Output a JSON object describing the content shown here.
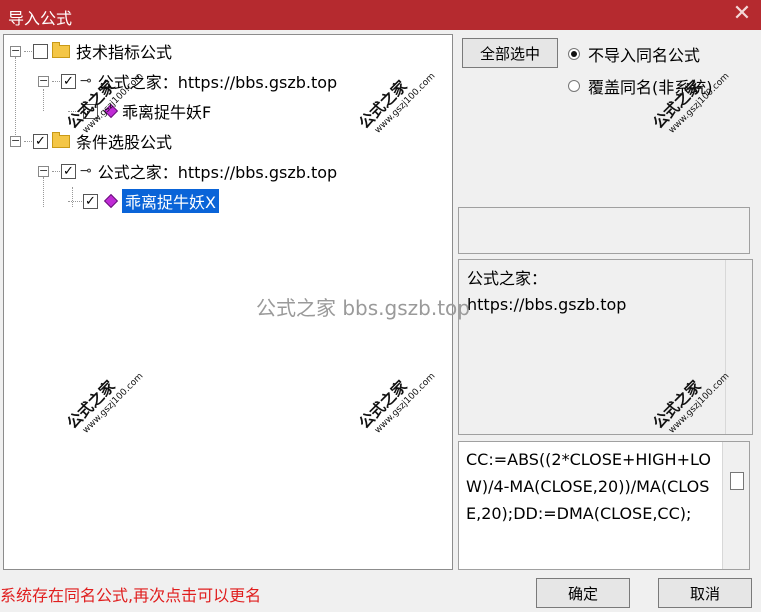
{
  "window": {
    "title": "导入公式",
    "close_glyph": "✕"
  },
  "tree": {
    "nodes": [
      {
        "label": "技术指标公式",
        "icon": "folder-icon",
        "checked": false
      },
      {
        "label": "公式之家：https://bbs.gszb.top",
        "icon": "key-icon",
        "checked": true
      },
      {
        "label": "乖离捉牛妖F",
        "icon": "gem-icon",
        "checked": true
      },
      {
        "label": "条件选股公式",
        "icon": "folder-icon",
        "checked": true
      },
      {
        "label": "公式之家：https://bbs.gszb.top",
        "icon": "key-icon",
        "checked": true
      },
      {
        "label": "乖离捉牛妖X",
        "icon": "gem-icon",
        "checked": true,
        "selected": true
      }
    ],
    "check_glyph": "✓",
    "expander_glyph": "−"
  },
  "options": {
    "select_all_label": "全部选中",
    "radio_no_import": "不导入同名公式",
    "radio_overwrite": "覆盖同名(非系统)"
  },
  "info": {
    "line1": "公式之家：",
    "line2": "https://bbs.gszb.top"
  },
  "code": {
    "text": "CC:=ABS((2*CLOSE+HIGH+LOW)/4-MA(CLOSE,20))/MA(CLOSE,20);DD:=DMA(CLOSE,CC);"
  },
  "status": {
    "message": "系统存在同名公式,再次点击可以更名"
  },
  "buttons": {
    "ok_label": "确定",
    "cancel_label": "取消"
  },
  "watermark": {
    "brand": "公式之家",
    "site": "www.gszj100.com",
    "center_text": "公式之家 bbs.gszb.top"
  },
  "colors": {
    "titlebar": "#b52a2f",
    "selection": "#0a64d8",
    "status_text": "#e01e1e"
  }
}
